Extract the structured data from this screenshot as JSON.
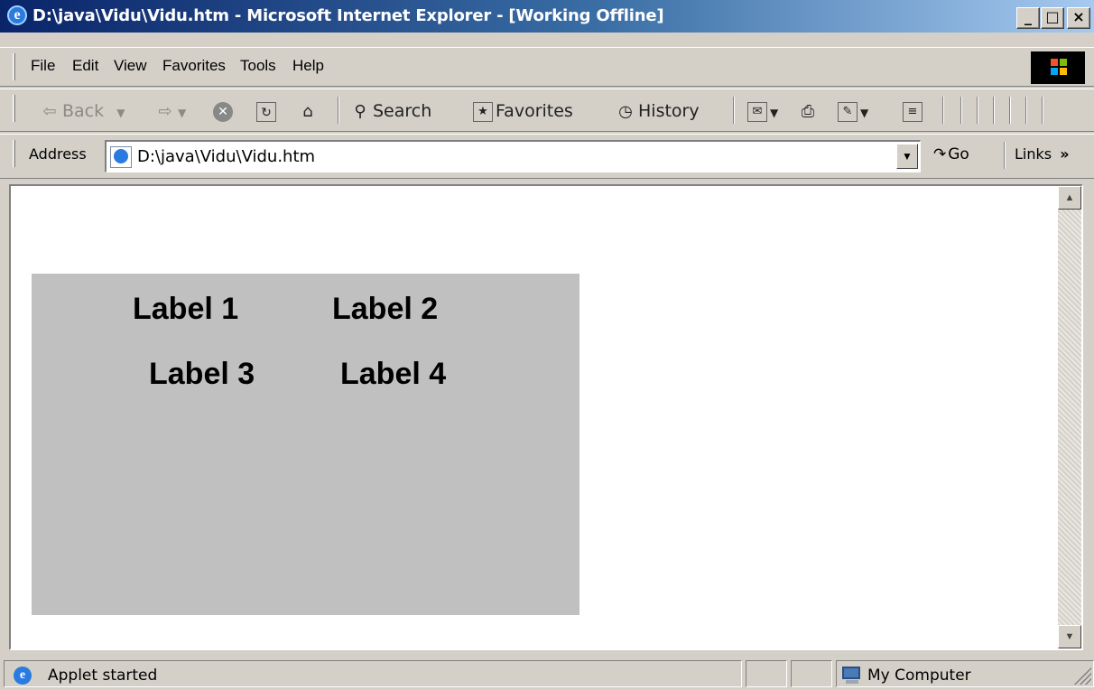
{
  "window": {
    "title": "D:\\java\\Vidu\\Vidu.htm - Microsoft Internet Explorer - [Working Offline]",
    "minimize": "_",
    "maximize": "□",
    "close": "×"
  },
  "menu": {
    "file": "File",
    "edit": "Edit",
    "view": "View",
    "favorites": "Favorites",
    "tools": "Tools",
    "help": "Help"
  },
  "toolbar": {
    "back": "Back",
    "search": "Search",
    "favorites": "Favorites",
    "history": "History"
  },
  "address": {
    "label": "Address",
    "value": "D:\\java\\Vidu\\Vidu.htm",
    "go": "Go",
    "links": "Links",
    "chevron": "»"
  },
  "applet": {
    "labels": [
      "Label 1",
      "Label 2",
      "Label 3",
      "Label 4"
    ],
    "background": "#c0c0c0"
  },
  "status": {
    "message": "Applet started",
    "zone": "My Computer"
  },
  "colors": {
    "titlebar_start": "#0a246a",
    "titlebar_end": "#a6caf0",
    "chrome": "#d4d0c8"
  }
}
